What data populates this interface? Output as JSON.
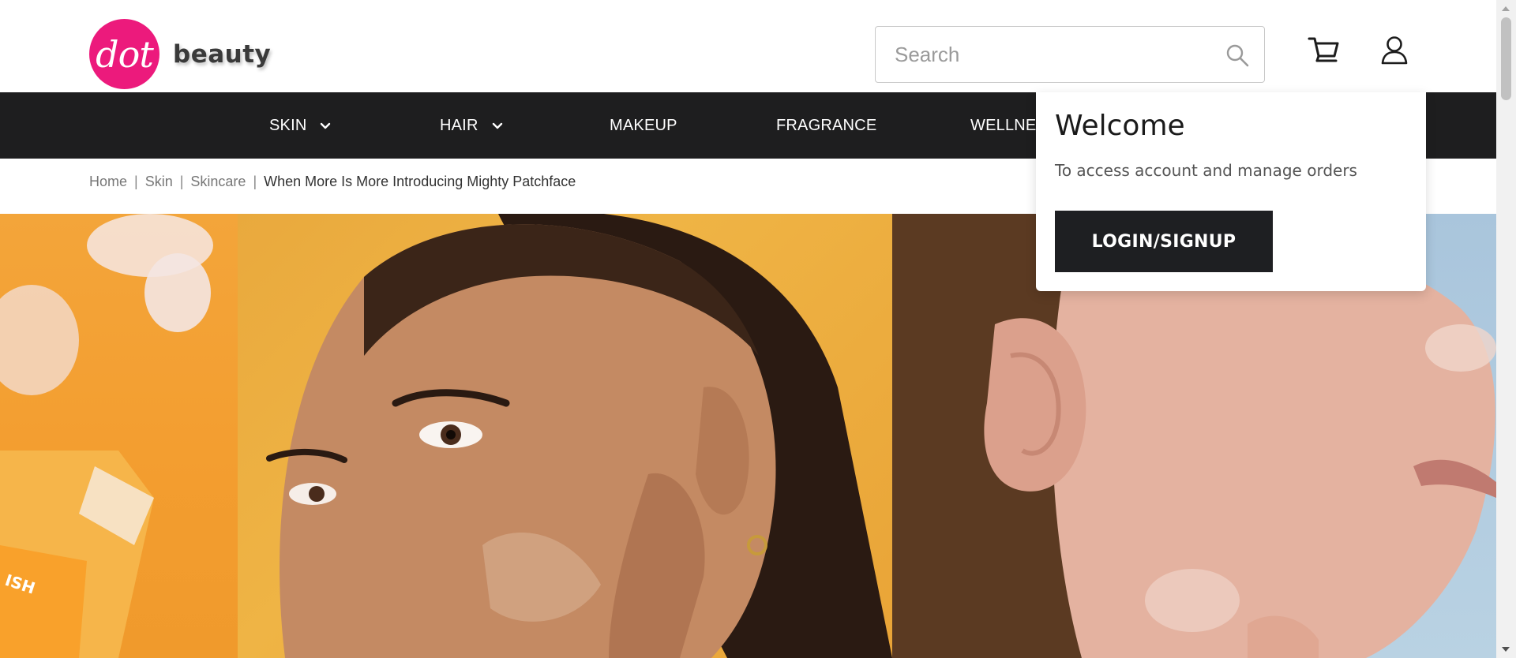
{
  "brand": {
    "logo_mark": "dot",
    "logo_word": "beauty",
    "accent_color": "#ec1a7c"
  },
  "search": {
    "placeholder": "Search",
    "value": "",
    "icon": "search-icon"
  },
  "header_icons": {
    "cart": "cart-icon",
    "account": "user-icon"
  },
  "nav": {
    "items": [
      {
        "label": "SKIN",
        "has_dropdown": true
      },
      {
        "label": "HAIR",
        "has_dropdown": true
      },
      {
        "label": "MAKEUP",
        "has_dropdown": false
      },
      {
        "label": "FRAGRANCE",
        "has_dropdown": false
      },
      {
        "label": "WELLNE",
        "has_dropdown": false
      }
    ],
    "background_color": "#1e1e1f"
  },
  "breadcrumb": {
    "items": [
      "Home",
      "Skin",
      "Skincare"
    ],
    "current": "When More Is More Introducing Mighty Patchface",
    "separator": "|"
  },
  "account_popup": {
    "title": "Welcome",
    "subtitle": "To access account and manage orders",
    "button_label": "LOGIN/SIGNUP"
  },
  "hero": {
    "panels": [
      "product-pouch-image",
      "woman-with-patch-image",
      "man-with-patch-image"
    ],
    "printed_text": "ISH"
  }
}
